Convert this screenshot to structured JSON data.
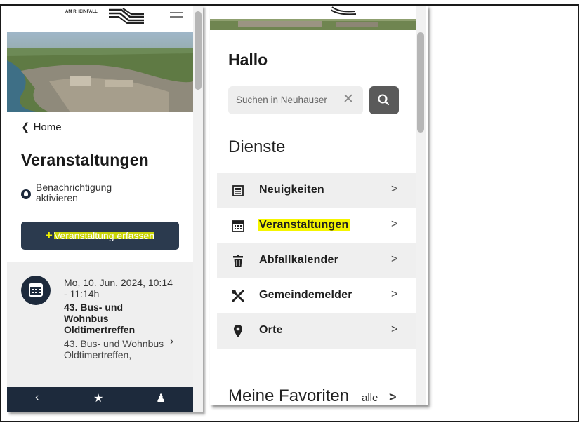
{
  "left_panel": {
    "logo_text": "AM RHEINFALL",
    "back_link": "Home",
    "page_title": "Veranstaltungen",
    "notification_label": "Benachrichtigung aktivieren",
    "add_button_plus": "+",
    "add_button_label": "Veranstaltung erfassen",
    "event": {
      "date": "Mo, 10. Jun. 2024, 10:14 - 11:14h",
      "title": "43. Bus- und Wohnbus Oldtimertreffen",
      "description": "43. Bus- und Wohnbus Oldtimertreffen,"
    },
    "bottom_nav_icons": [
      "share-icon",
      "star-icon",
      "bell-icon"
    ]
  },
  "right_panel": {
    "greeting": "Hallo",
    "search": {
      "placeholder": "Suchen in Neuhausen",
      "value": "Suchen in Neuhauser"
    },
    "section_title": "Dienste",
    "menu_items": [
      {
        "label": "Neuigkeiten",
        "icon": "newspaper-icon"
      },
      {
        "label": "Veranstaltungen",
        "icon": "calendar-icon",
        "highlighted": true
      },
      {
        "label": "Abfallkalender",
        "icon": "trash-icon"
      },
      {
        "label": "Gemeindemelder",
        "icon": "tools-icon"
      },
      {
        "label": "Orte",
        "icon": "map-pin-icon"
      }
    ],
    "favorites_title": "Meine Favoriten",
    "favorites_link": "alle"
  },
  "colors": {
    "navy": "#1d2a3c",
    "button_navy": "#2b3a4e",
    "highlight": "#f5f500",
    "row_alt": "#efefef"
  }
}
